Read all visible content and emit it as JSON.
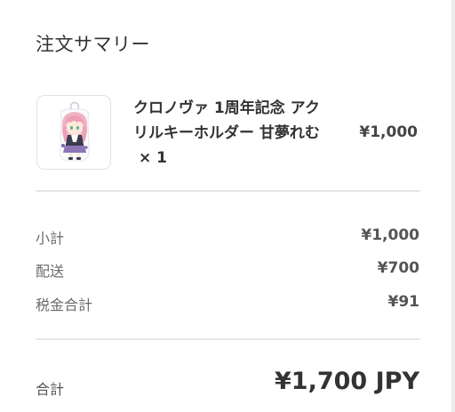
{
  "summary": {
    "title": "注文サマリー"
  },
  "item": {
    "image_icon": "acrylic-keychain-character-thumbnail",
    "name": "クロノヴァ 1周年記念 アクリルキーホルダー 甘夢れむ",
    "quantity": "× 1",
    "price": "¥1,000"
  },
  "rows": [
    {
      "label": "小計",
      "value": "¥1,000"
    },
    {
      "label": "配送",
      "value": "¥700"
    },
    {
      "label": "税金合計",
      "value": "¥91"
    }
  ],
  "total": {
    "label": "合計",
    "value": "¥1,700 JPY"
  },
  "colors": {
    "text_primary": "#333333",
    "text_secondary": "#6b6b6b",
    "divider": "#e6e6e6",
    "thumb_border": "#e2e2e2"
  }
}
